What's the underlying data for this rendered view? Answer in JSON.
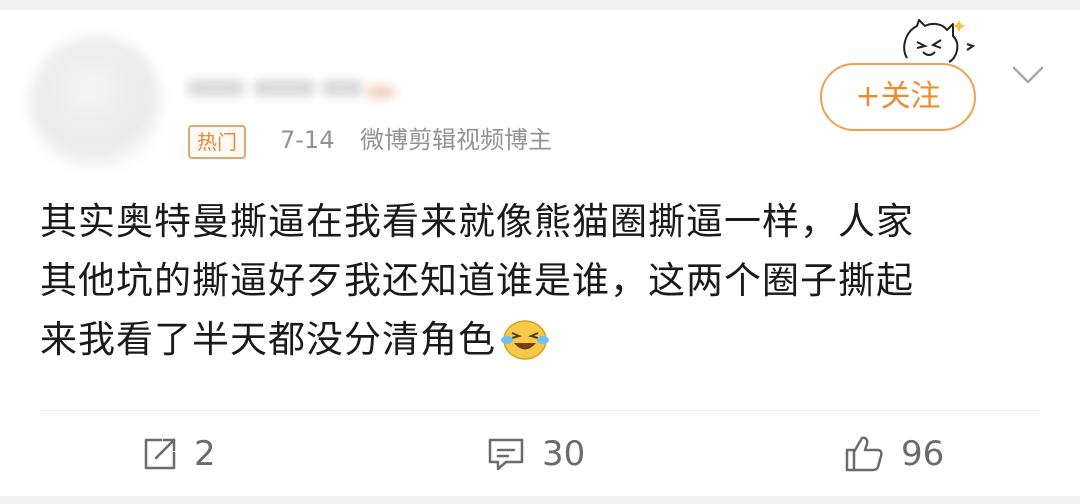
{
  "post": {
    "hot_badge": "热门",
    "date": "7-14",
    "source": "微博剪辑视频博主",
    "follow_label": "+关注",
    "content_lines": [
      "其实奥特曼撕逼在我看来就像熊猫圈撕逼一样，人家",
      "其他坑的撕逼好歹我还知道谁是谁，这两个圈子撕起",
      "来我看了半天都没分清角色"
    ],
    "emoji": "laughing-crying-emoji"
  },
  "actions": {
    "repost_count": "2",
    "comment_count": "30",
    "like_count": "96"
  },
  "colors": {
    "accent": "#f08a2a",
    "badge": "#e08a3a",
    "meta_text": "#939393",
    "action_text": "#6b6b6b"
  },
  "icons": [
    "repost-icon",
    "comment-icon",
    "like-icon",
    "chevron-down-icon",
    "cat-sticker-icon"
  ]
}
